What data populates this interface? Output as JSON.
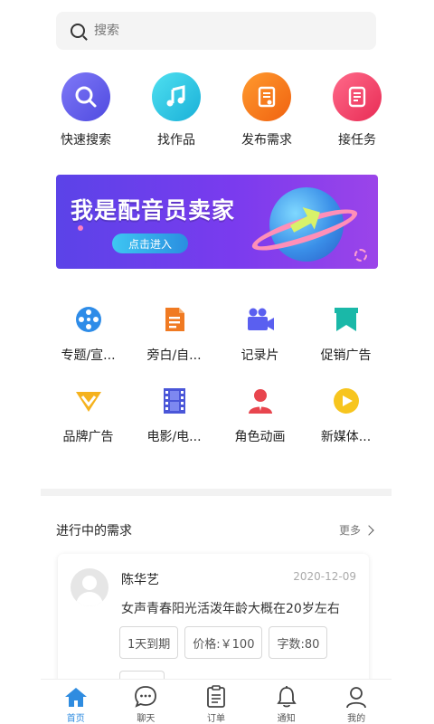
{
  "search": {
    "placeholder": "搜索"
  },
  "quick_actions": [
    {
      "label": "快速搜索",
      "icon": "search-icon",
      "color": "#6b63f2"
    },
    {
      "label": "找作品",
      "icon": "music-note-icon",
      "color": "#2cc7e0"
    },
    {
      "label": "发布需求",
      "icon": "publish-doc-icon",
      "color": "#f5781e"
    },
    {
      "label": "接任务",
      "icon": "task-list-icon",
      "color": "#f0436c"
    }
  ],
  "banner": {
    "title": "我是配音员卖家",
    "button": "点击进入"
  },
  "categories": [
    {
      "label": "专题/宣...",
      "icon": "film-reel-icon"
    },
    {
      "label": "旁白/自...",
      "icon": "document-icon"
    },
    {
      "label": "记录片",
      "icon": "video-camera-icon"
    },
    {
      "label": "促销广告",
      "icon": "bookmark-icon"
    },
    {
      "label": "品牌广告",
      "icon": "brand-v-icon"
    },
    {
      "label": "电影/电...",
      "icon": "film-strip-icon"
    },
    {
      "label": "角色动画",
      "icon": "character-icon"
    },
    {
      "label": "新媒体...",
      "icon": "play-circle-icon"
    }
  ],
  "section": {
    "title": "进行中的需求",
    "more": "更多"
  },
  "demand": {
    "name": "陈华艺",
    "date": "2020-12-09",
    "description": "女声青春阳光活泼年龄大概在20岁左右",
    "tags": [
      "1天到期",
      "价格:￥100",
      "字数:80"
    ]
  },
  "tabbar": [
    {
      "label": "首页",
      "icon": "home-icon",
      "active": true
    },
    {
      "label": "聊天",
      "icon": "chat-icon",
      "active": false
    },
    {
      "label": "订单",
      "icon": "order-icon",
      "active": false
    },
    {
      "label": "通知",
      "icon": "bell-icon",
      "active": false
    },
    {
      "label": "我的",
      "icon": "user-icon",
      "active": false
    }
  ],
  "colors": {
    "accent": "#2f8ce0",
    "tag_border": "#d8d8d8"
  }
}
